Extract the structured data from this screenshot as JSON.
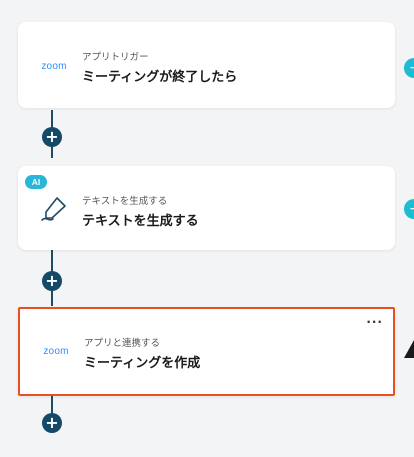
{
  "flow": {
    "steps": [
      {
        "logo": "zoom",
        "subtitle": "アプリトリガー",
        "title": "ミーティングが終了したら"
      },
      {
        "badge": "AI",
        "icon": "pen-squiggle-icon",
        "subtitle": "テキストを生成する",
        "title": "テキストを生成する"
      },
      {
        "logo": "zoom",
        "subtitle": "アプリと連携する",
        "title": "ミーティングを作成",
        "more": "···"
      }
    ],
    "add_label": "+"
  },
  "colors": {
    "zoom_logo": "#2d8cff",
    "selected_border": "#e8501f",
    "add_button": "#144a68",
    "ai_badge": "#28b6d9"
  }
}
